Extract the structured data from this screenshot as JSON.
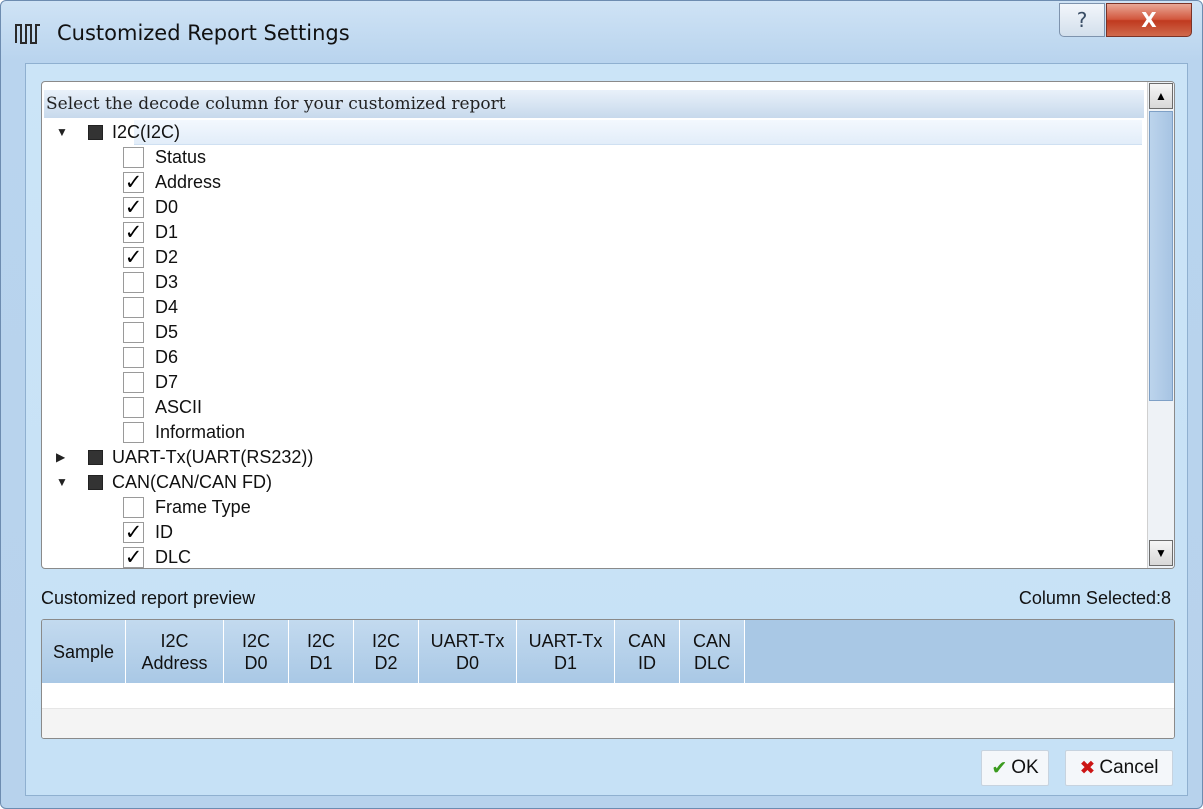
{
  "window": {
    "title": "Customized Report Settings",
    "icon": "waveform-icon",
    "controls": {
      "help": "?",
      "close": "X"
    }
  },
  "tree": {
    "header": "Select the decode column for your customized report",
    "groups": [
      {
        "label": "I2C(I2C)",
        "expanded": true,
        "children": [
          {
            "label": "Status",
            "checked": false
          },
          {
            "label": "Address",
            "checked": true
          },
          {
            "label": "D0",
            "checked": true
          },
          {
            "label": "D1",
            "checked": true
          },
          {
            "label": "D2",
            "checked": true
          },
          {
            "label": "D3",
            "checked": false
          },
          {
            "label": "D4",
            "checked": false
          },
          {
            "label": "D5",
            "checked": false
          },
          {
            "label": "D6",
            "checked": false
          },
          {
            "label": "D7",
            "checked": false
          },
          {
            "label": "ASCII",
            "checked": false
          },
          {
            "label": "Information",
            "checked": false
          }
        ]
      },
      {
        "label": "UART-Tx(UART(RS232))",
        "expanded": false,
        "children": []
      },
      {
        "label": "CAN(CAN/CAN FD)",
        "expanded": true,
        "children": [
          {
            "label": "Frame Type",
            "checked": false
          },
          {
            "label": "ID",
            "checked": true
          },
          {
            "label": "DLC",
            "checked": true
          }
        ]
      }
    ]
  },
  "preview": {
    "label": "Customized report preview",
    "column_count": "Column Selected:8",
    "columns": [
      {
        "line1": "Sample",
        "line2": ""
      },
      {
        "line1": "I2C",
        "line2": "Address"
      },
      {
        "line1": "I2C",
        "line2": "D0"
      },
      {
        "line1": "I2C",
        "line2": "D1"
      },
      {
        "line1": "I2C",
        "line2": "D2"
      },
      {
        "line1": "UART-Tx",
        "line2": "D0"
      },
      {
        "line1": "UART-Tx",
        "line2": "D1"
      },
      {
        "line1": "CAN",
        "line2": "ID"
      },
      {
        "line1": "CAN",
        "line2": "DLC"
      }
    ]
  },
  "buttons": {
    "ok": "OK",
    "cancel": "Cancel"
  },
  "colors": {
    "window_bg": "#b9d4ee",
    "client_bg": "#c9e2f6",
    "header_bg": "#b2cfe8",
    "close_btn": "#c9452a",
    "ok_icon": "#3a9b1e",
    "cancel_icon": "#cc1515"
  }
}
